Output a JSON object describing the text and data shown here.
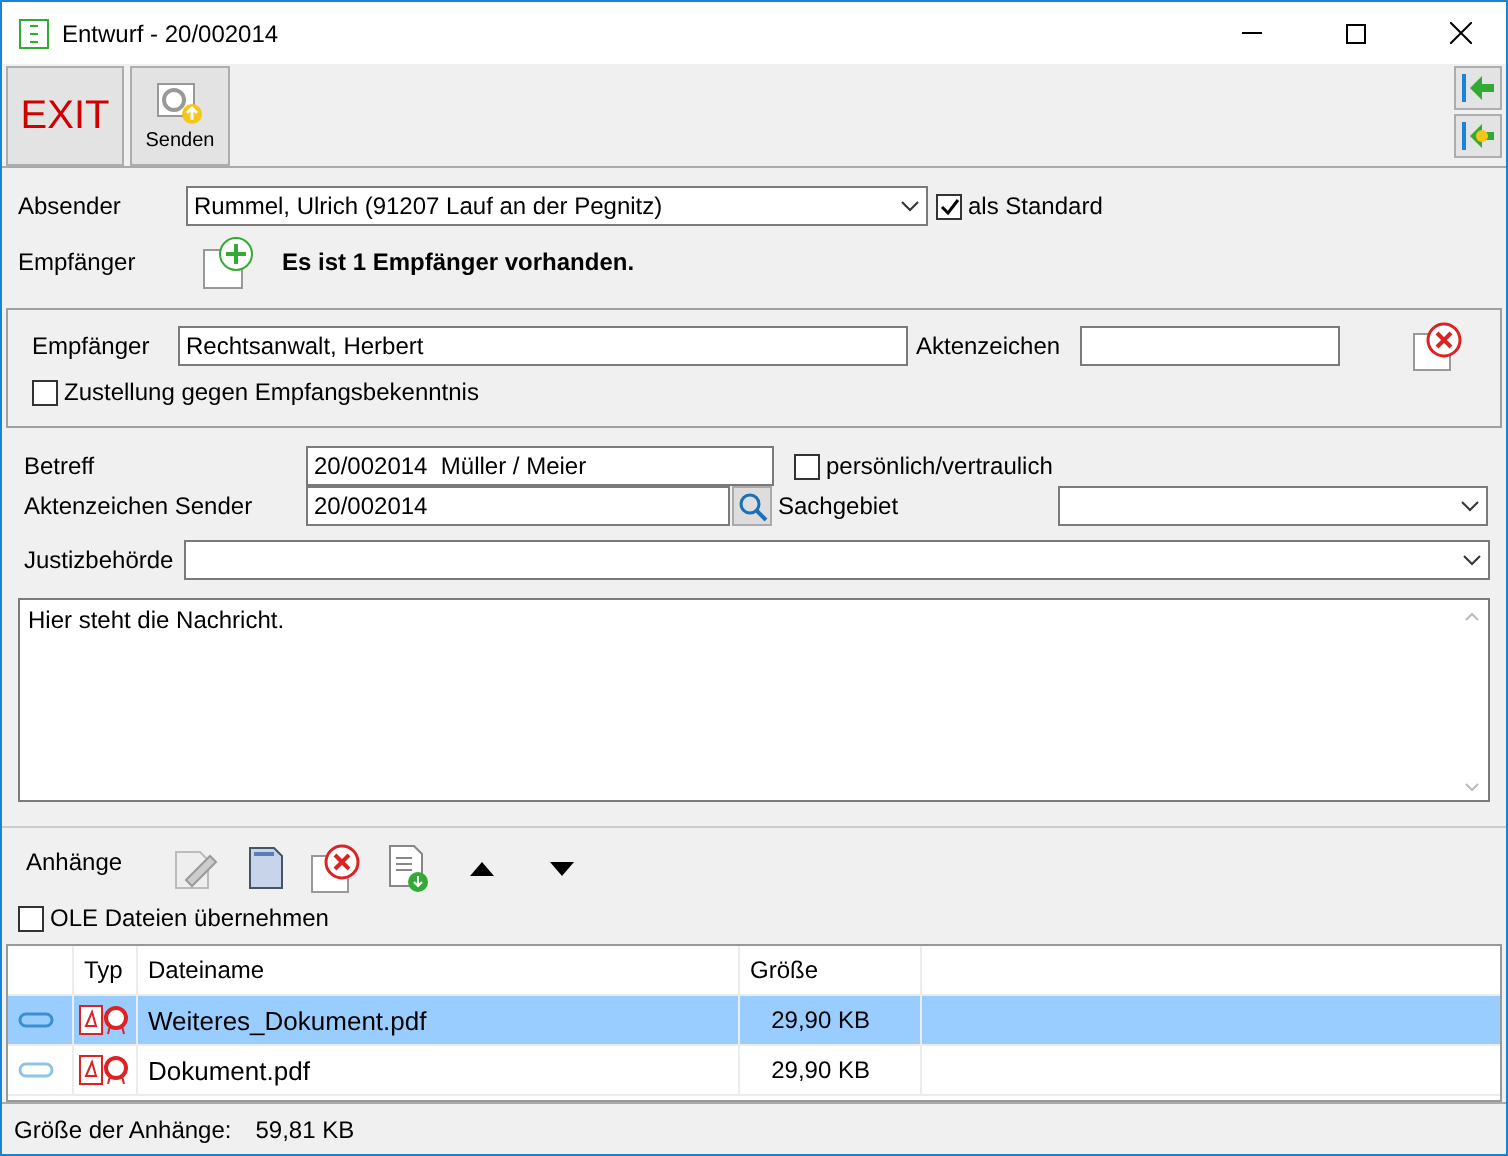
{
  "window": {
    "title": "Entwurf - 20/002014"
  },
  "toolbar": {
    "exit": "EXIT",
    "send": "Senden"
  },
  "sender": {
    "label": "Absender",
    "value": "Rummel, Ulrich (91207 Lauf an der Pegnitz)",
    "default_label": "als Standard",
    "default_checked": true
  },
  "recipients": {
    "label": "Empfänger",
    "info": "Es ist 1 Empfänger vorhanden."
  },
  "recipient": {
    "label": "Empfänger",
    "value": "Rechtsanwalt, Herbert",
    "ref_label": "Aktenzeichen",
    "receipt_label": "Zustellung gegen Empfangsbekenntnis",
    "receipt_checked": false
  },
  "subject": {
    "label": "Betreff",
    "value": "20/002014  Müller / Meier",
    "private_label": "persönlich/vertraulich",
    "private_checked": false
  },
  "sender_ref": {
    "label": "Aktenzeichen Sender",
    "value": "20/002014",
    "area_label": "Sachgebiet"
  },
  "authority": {
    "label": "Justizbehörde"
  },
  "message": {
    "value": "Hier steht die Nachricht."
  },
  "attachments": {
    "label": "Anhänge",
    "ole_label": "OLE Dateien übernehmen",
    "ole_checked": false,
    "columns": [
      "Typ",
      "Dateiname",
      "Größe"
    ],
    "rows": [
      {
        "name": "Weiteres_Dokument.pdf",
        "size": "29,90 KB",
        "selected": true
      },
      {
        "name": "Dokument.pdf",
        "size": "29,90 KB",
        "selected": false
      }
    ]
  },
  "status_bar": {
    "label": "Größe der Anhänge:",
    "value": "59,81 KB"
  }
}
